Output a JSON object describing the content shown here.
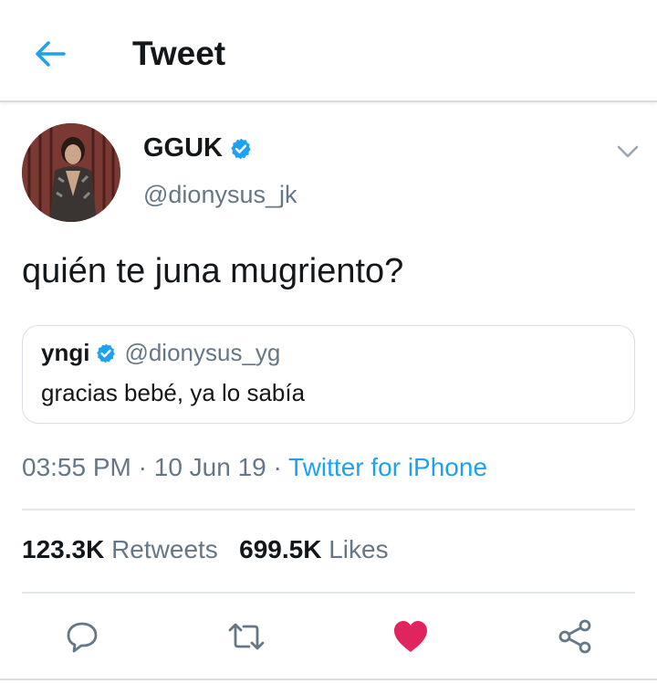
{
  "header": {
    "title": "Tweet",
    "back_icon": "arrow-left-icon"
  },
  "tweet": {
    "author": {
      "display_name": "GGUK",
      "handle": "@dionysus_jk",
      "verified": true
    },
    "text": "quién te juna mugriento?",
    "quoted": {
      "display_name": "yngi",
      "handle": "@dionysus_yg",
      "verified": true,
      "text": "gracias bebé, ya lo sabía"
    },
    "meta": {
      "time": "03:55 PM",
      "separator": "·",
      "date": "10 Jun 19",
      "source": "Twitter for iPhone"
    },
    "stats": {
      "retweets_count": "123.3K",
      "retweets_label": "Retweets",
      "likes_count": "699.5K",
      "likes_label": "Likes"
    },
    "actions": [
      "reply-icon",
      "retweet-icon",
      "like-icon",
      "share-icon"
    ]
  },
  "colors": {
    "accent": "#1da1f2",
    "like": "#e0245e",
    "secondary_text": "#657786"
  }
}
